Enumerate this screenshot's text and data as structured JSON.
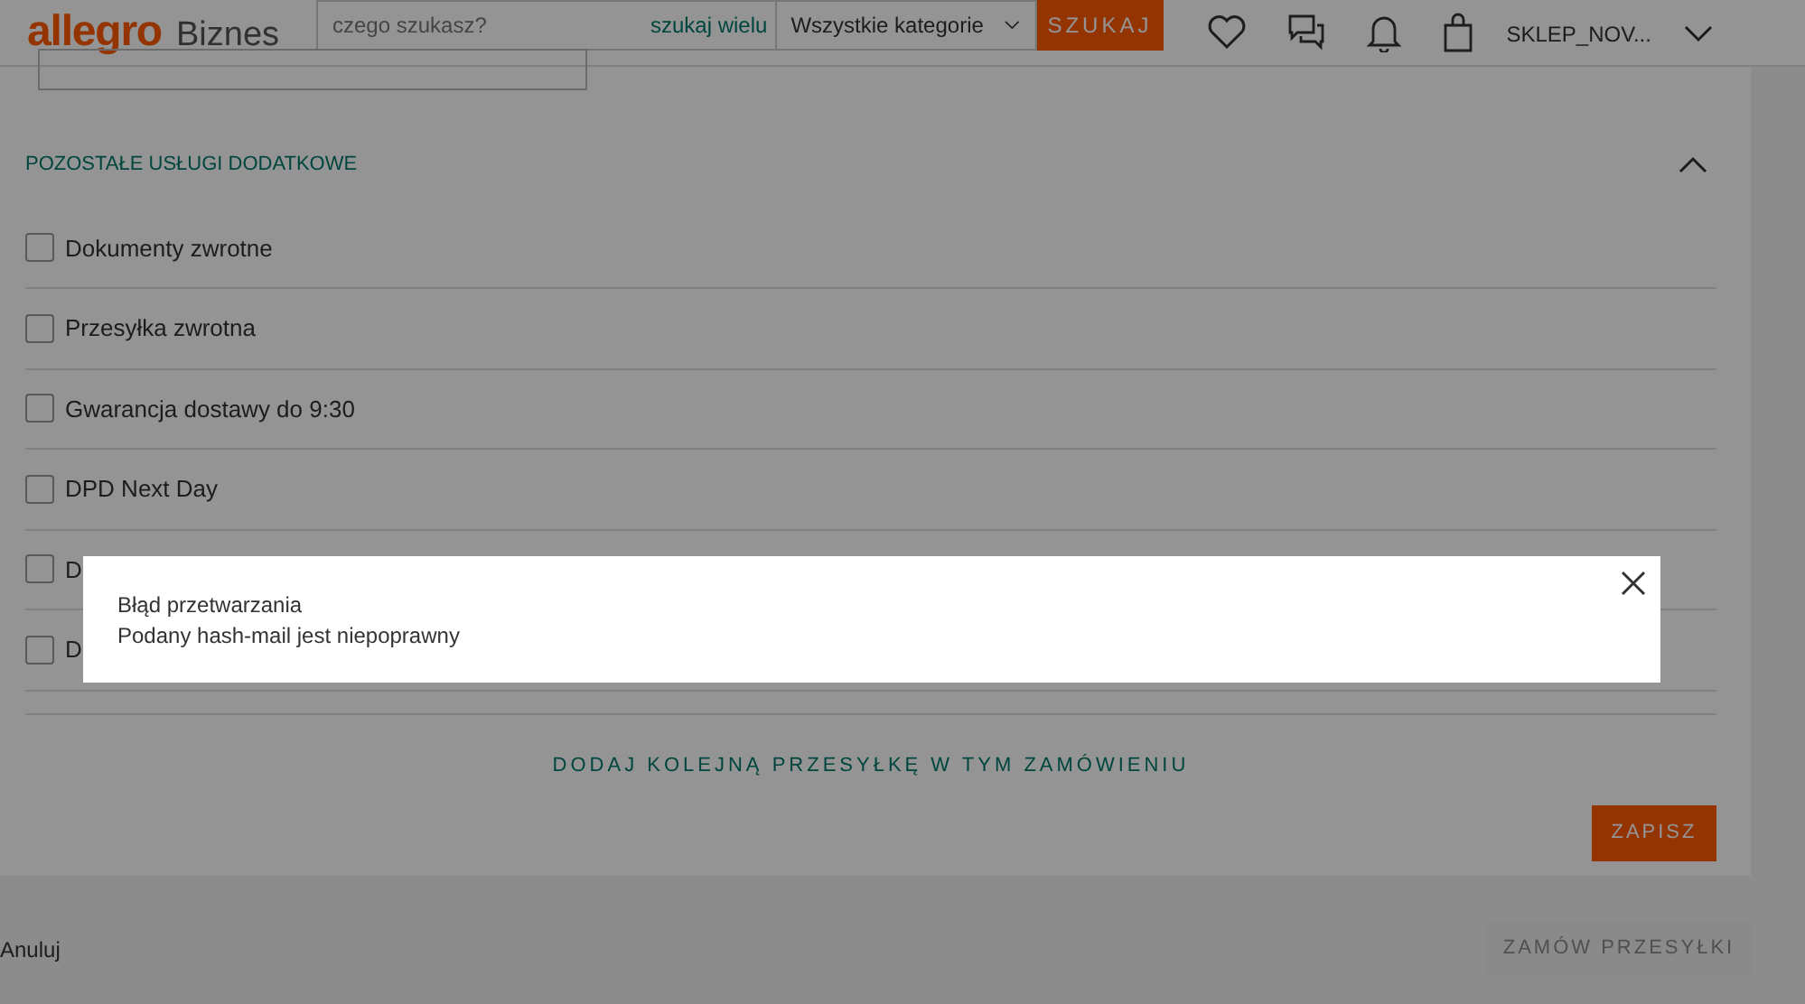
{
  "header": {
    "logo": "allegro",
    "logo_suffix": "Biznes",
    "search": {
      "placeholder": "czego szukasz?"
    },
    "multi_search": "szukaj wielu",
    "category": "Wszystkie kategorie",
    "search_button": "SZUKAJ",
    "account": "SKLEP_NOV..."
  },
  "section": {
    "title": "POZOSTAŁE USŁUGI DODATKOWE",
    "expanded": true,
    "options": [
      {
        "label": "Dokumenty zwrotne",
        "checked": false
      },
      {
        "label": "Przesyłka zwrotna",
        "checked": false
      },
      {
        "label": "Gwarancja dostawy do 9:30",
        "checked": false
      },
      {
        "label": "DPD Next Day",
        "checked": false
      },
      {
        "label": "D",
        "checked": false
      },
      {
        "label": "D",
        "checked": false
      }
    ]
  },
  "add_link": "DODAJ KOLEJNĄ PRZESYŁKĘ W TYM ZAMÓWIENIU",
  "save_button": "ZAPISZ",
  "cancel_link": "Anuluj",
  "order_button": {
    "label": "ZAMÓW PRZESYŁKI",
    "disabled": true
  },
  "dialog": {
    "title": "Błąd przetwarzania",
    "message": "Podany hash-mail jest niepoprawny"
  }
}
